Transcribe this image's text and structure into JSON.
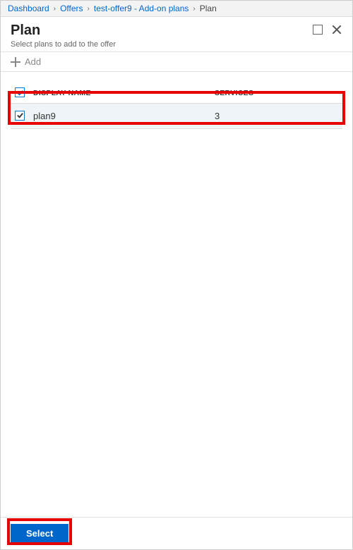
{
  "breadcrumb": {
    "items": [
      {
        "label": "Dashboard",
        "current": false
      },
      {
        "label": "Offers",
        "current": false
      },
      {
        "label": "test-offer9 - Add-on plans",
        "current": false
      },
      {
        "label": "Plan",
        "current": true
      }
    ]
  },
  "blade": {
    "title": "Plan",
    "subtitle": "Select plans to add to the offer"
  },
  "toolbar": {
    "add_label": "Add"
  },
  "table": {
    "columns": {
      "display_name": "DISPLAY NAME",
      "services": "SERVICES"
    },
    "rows": [
      {
        "checked": true,
        "display_name": "plan9",
        "services": "3"
      }
    ]
  },
  "footer": {
    "select_label": "Select"
  }
}
